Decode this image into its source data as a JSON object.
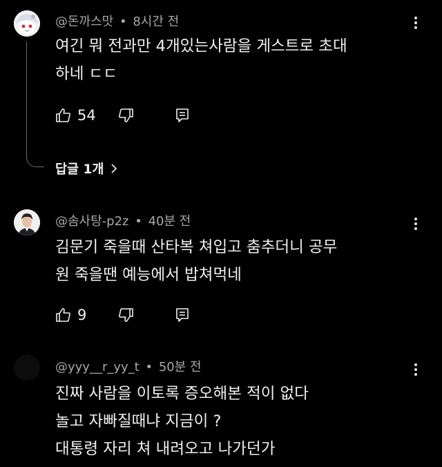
{
  "comments": [
    {
      "author": "@돈까스맛",
      "time": "8시간 전",
      "lines": [
        "여긴 뭐 전과만 4개있는사람을 게스트로 초대",
        "하네 ㄷㄷ"
      ],
      "likes": "54",
      "replies_label": "답글 1개"
    },
    {
      "author": "@솜사탕-p2z",
      "time": "40분 전",
      "lines": [
        "김문기 죽을때 산타복 쳐입고 춤추더니 공무",
        "원 죽을땐 예능에서 밥쳐먹네"
      ],
      "likes": "9"
    },
    {
      "author": "@yyy__r_yy_t",
      "time": "50분 전",
      "lines": [
        "진짜 사람을 이토록 증오해본 적이 없다",
        "놀고 자빠질때냐 지금이 ?",
        "대통령 자리 쳐 내려오고 나가던가"
      ]
    }
  ],
  "separator": "•",
  "colors": {
    "background": "#000000",
    "text": "#f1f1f1",
    "meta": "#a8a8a8"
  },
  "icons": [
    "like-icon",
    "dislike-icon",
    "reply-icon",
    "more-vert-icon",
    "chevron-right-icon"
  ]
}
